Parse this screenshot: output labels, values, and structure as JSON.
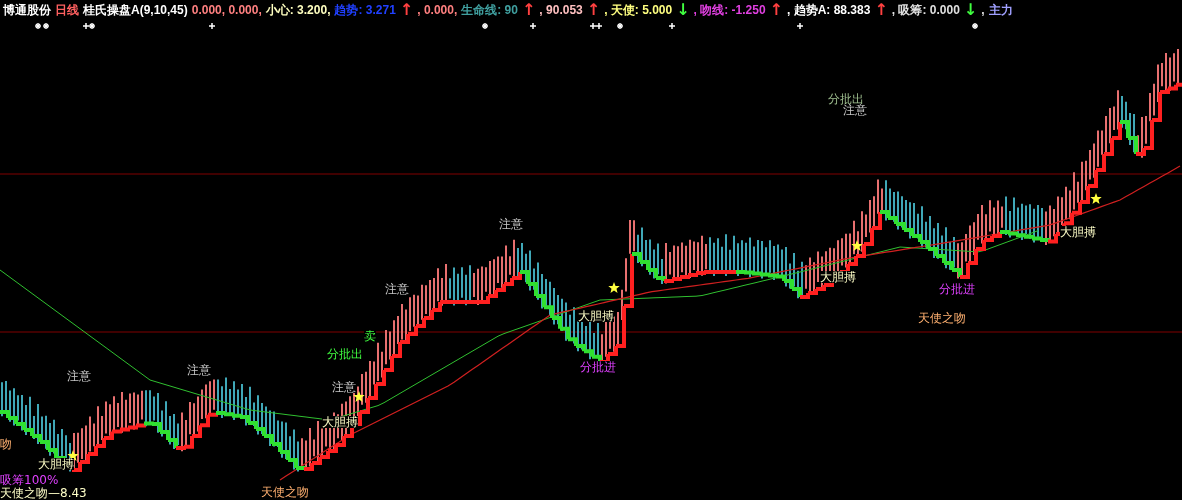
{
  "header": {
    "stock": "博通股份",
    "period": "日线",
    "indicator": "桂氏操盘A(9,10,45)",
    "values": [
      {
        "text": "0.000, 0.000,",
        "color": "#ff8080"
      },
      {
        "text": "小心: 3.200,",
        "color": "#ffffc0"
      },
      {
        "text": "趋势: 3.271",
        "color": "#2040ff"
      },
      {
        "text": "↑",
        "color": "#ff4040",
        "kind": "arrow"
      },
      {
        "text": ", 0.000,",
        "color": "#ff8080"
      },
      {
        "text": "生命线: 90",
        "color": "#40a0a0"
      },
      {
        "text": "↑",
        "color": "#ff4040",
        "kind": "arrow"
      },
      {
        "text": ", 90.053",
        "color": "#ffc0c0"
      },
      {
        "text": "↑",
        "color": "#ff4040",
        "kind": "arrow"
      },
      {
        "text": ", 天使: 5.000",
        "color": "#ffff80"
      },
      {
        "text": "↓",
        "color": "#40ff40",
        "kind": "arrow"
      },
      {
        "text": ", 吻线: -1.250",
        "color": "#e040e0"
      },
      {
        "text": "↑",
        "color": "#ff4040",
        "kind": "arrow"
      },
      {
        "text": ", 趋势A: 88.383",
        "color": "#ffffff"
      },
      {
        "text": "↑",
        "color": "#ff4040",
        "kind": "arrow"
      },
      {
        "text": ", 吸筹: 0.000",
        "color": "#e0e0e0"
      },
      {
        "text": "↓",
        "color": "#40ff40",
        "kind": "arrow"
      },
      {
        "text": ","
      },
      {
        "text": "主力",
        "color": "#a0a0ff"
      }
    ]
  },
  "annotations": [
    {
      "text": "分批出",
      "kind": "batch-sell"
    },
    {
      "text": "注意",
      "kind": "attention"
    },
    {
      "text": "注意",
      "kind": "attention"
    },
    {
      "text": "注意",
      "kind": "attention"
    },
    {
      "text": "大胆搏",
      "kind": "bold-buy"
    },
    {
      "text": "卖",
      "kind": "sell"
    },
    {
      "text": "分批出",
      "kind": "sell"
    },
    {
      "text": "分批进",
      "kind": "batch-buy"
    },
    {
      "text": "注意",
      "kind": "attention"
    },
    {
      "text": "注意",
      "kind": "attention"
    },
    {
      "text": "注意",
      "kind": "attention"
    },
    {
      "text": "大胆搏",
      "kind": "bold-buy"
    },
    {
      "text": "大胆搏",
      "kind": "bold-buy"
    },
    {
      "text": "天使之吻",
      "kind": "angel"
    },
    {
      "text": "大胆搏",
      "kind": "bold-buy"
    },
    {
      "text": "分批进",
      "kind": "batch-buy"
    },
    {
      "text": "天使之吻",
      "kind": "angel"
    },
    {
      "text": "大胆搏",
      "kind": "bold-buy"
    },
    {
      "text": "吻",
      "kind": "angel"
    },
    {
      "text": "吸筹100%",
      "kind": "batch-buy"
    },
    {
      "text": "天使之吻—8.43",
      "kind": "bold-buy"
    }
  ]
}
